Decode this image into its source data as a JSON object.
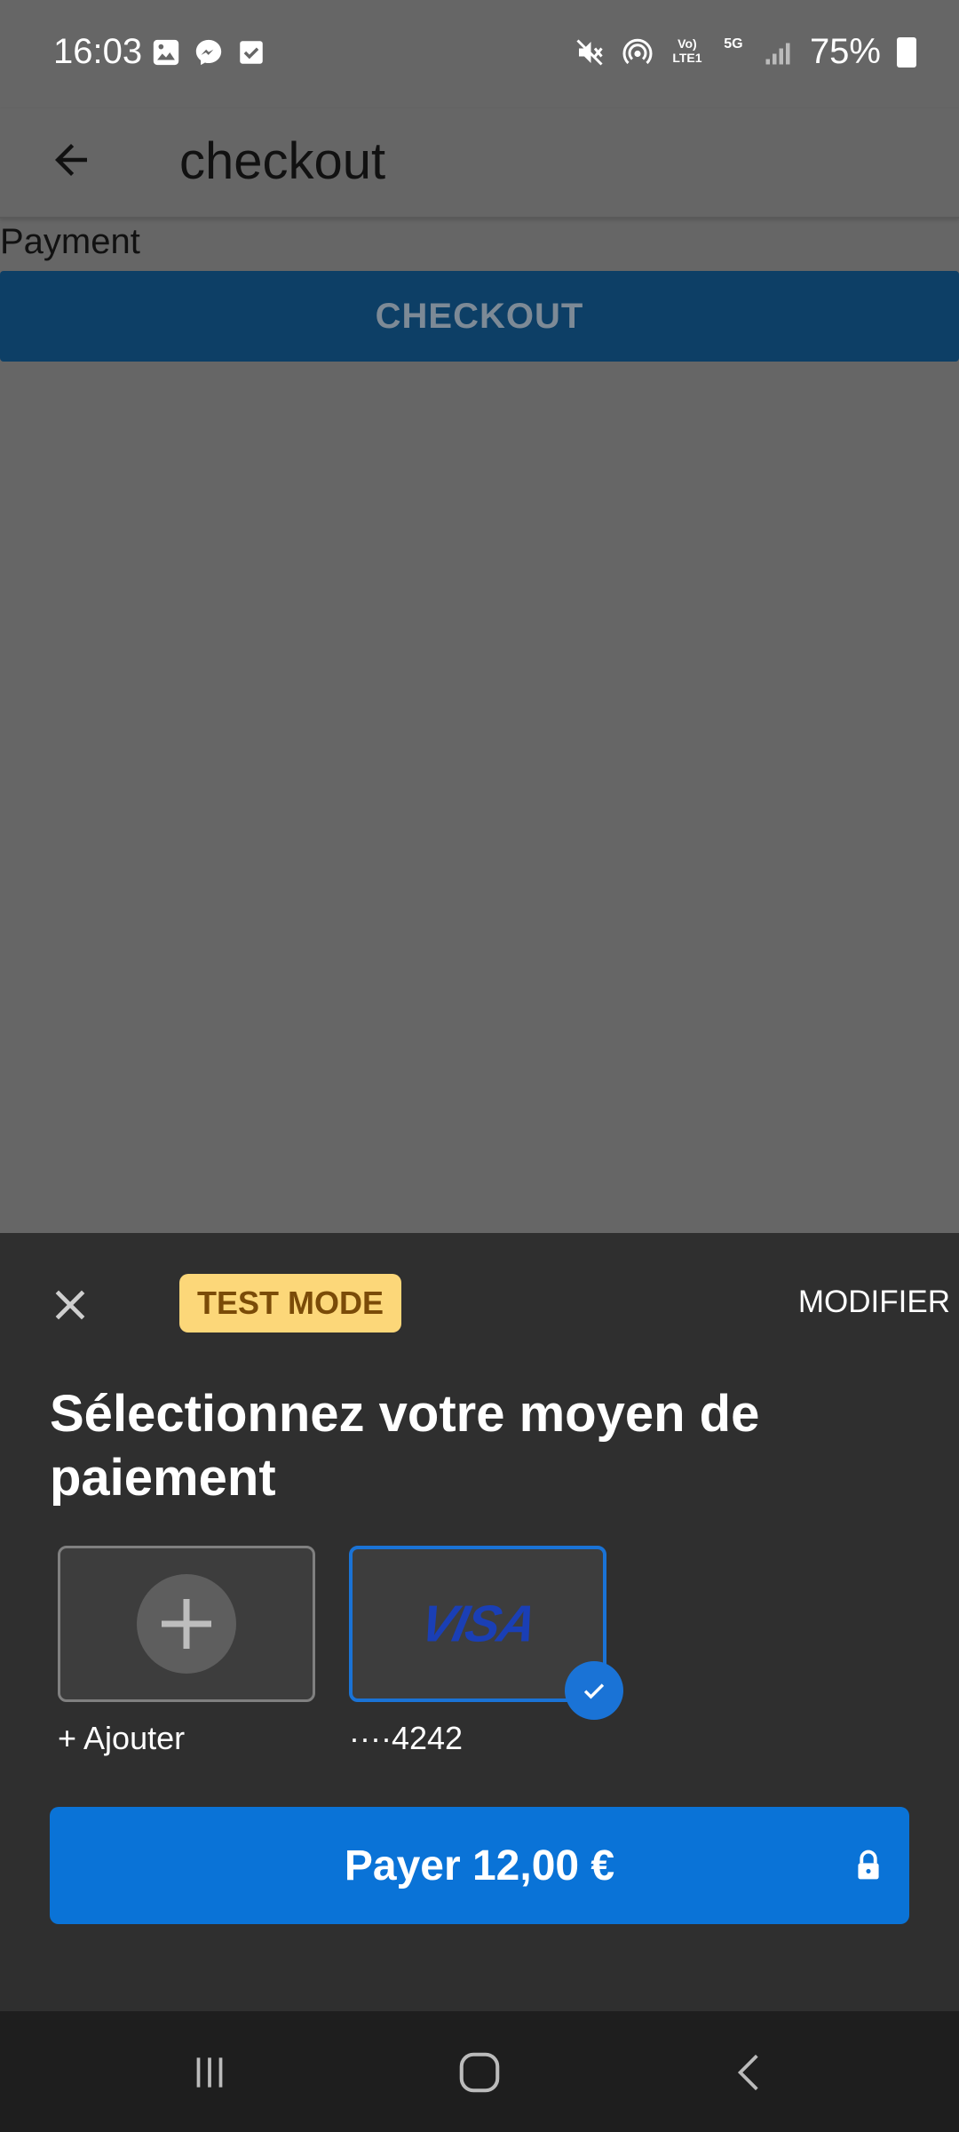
{
  "status_bar": {
    "time": "16:03",
    "battery": "75%",
    "left_icons": [
      "gallery-icon",
      "messenger-icon",
      "task-check-icon"
    ],
    "right_icons": [
      "mute-icon",
      "hotspot-icon",
      "volte-icon",
      "5g-icon",
      "signal-icon",
      "battery-icon"
    ],
    "volte_text": "Vo) LTE1",
    "network_text": "5G"
  },
  "app_bar": {
    "title": "checkout",
    "back_icon": "arrow-back-icon"
  },
  "page": {
    "payment_label": "Payment",
    "checkout_button": "CHECKOUT"
  },
  "sheet": {
    "test_mode_badge": "TEST MODE",
    "modify_button": "MODIFIER",
    "title": "Sélectionnez votre moyen de paiement",
    "payment_methods": [
      {
        "label": "+ Ajouter",
        "icon": "plus-icon",
        "selected": false
      },
      {
        "label": "····4242",
        "brand": "VISA",
        "selected": true
      }
    ],
    "pay_button": "Payer 12,00 €",
    "colors": {
      "accent": "#0a73d7",
      "badge_bg": "#fcd779",
      "badge_text": "#7a4b08",
      "sheet_bg": "#2f2f2f"
    }
  },
  "nav_bar": {
    "buttons": [
      "recent-apps-icon",
      "home-icon",
      "back-icon"
    ]
  }
}
